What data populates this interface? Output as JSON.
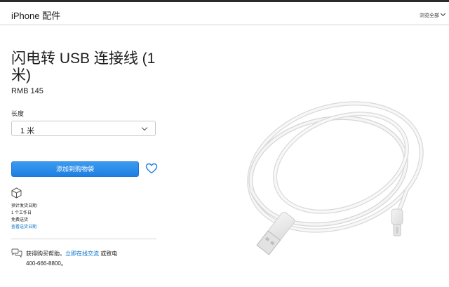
{
  "header": {
    "title": "iPhone 配件",
    "browse_all": "浏览全部"
  },
  "product": {
    "title": "闪电转 USB 连接线 (1 米)",
    "price": "RMB 145"
  },
  "options": {
    "length_label": "长度",
    "length_value": "1 米"
  },
  "actions": {
    "add_to_bag": "添加到购物袋"
  },
  "shipping": {
    "estimated_label": "预计发货日期:",
    "days": "1 个工作日",
    "free": "免费送货",
    "details_link": "查看送货日期"
  },
  "help": {
    "prefix": "获得购买帮助。",
    "chat_link": "立即在线交流",
    "or_call": " 或致电",
    "phone": "400-666-8800。"
  },
  "icons": {
    "heart": "heart-icon",
    "box": "box-icon",
    "chat": "chat-icon",
    "chevron": "chevron-down-icon"
  },
  "colors": {
    "accent": "#0070c9",
    "button": "#2f8ded"
  }
}
